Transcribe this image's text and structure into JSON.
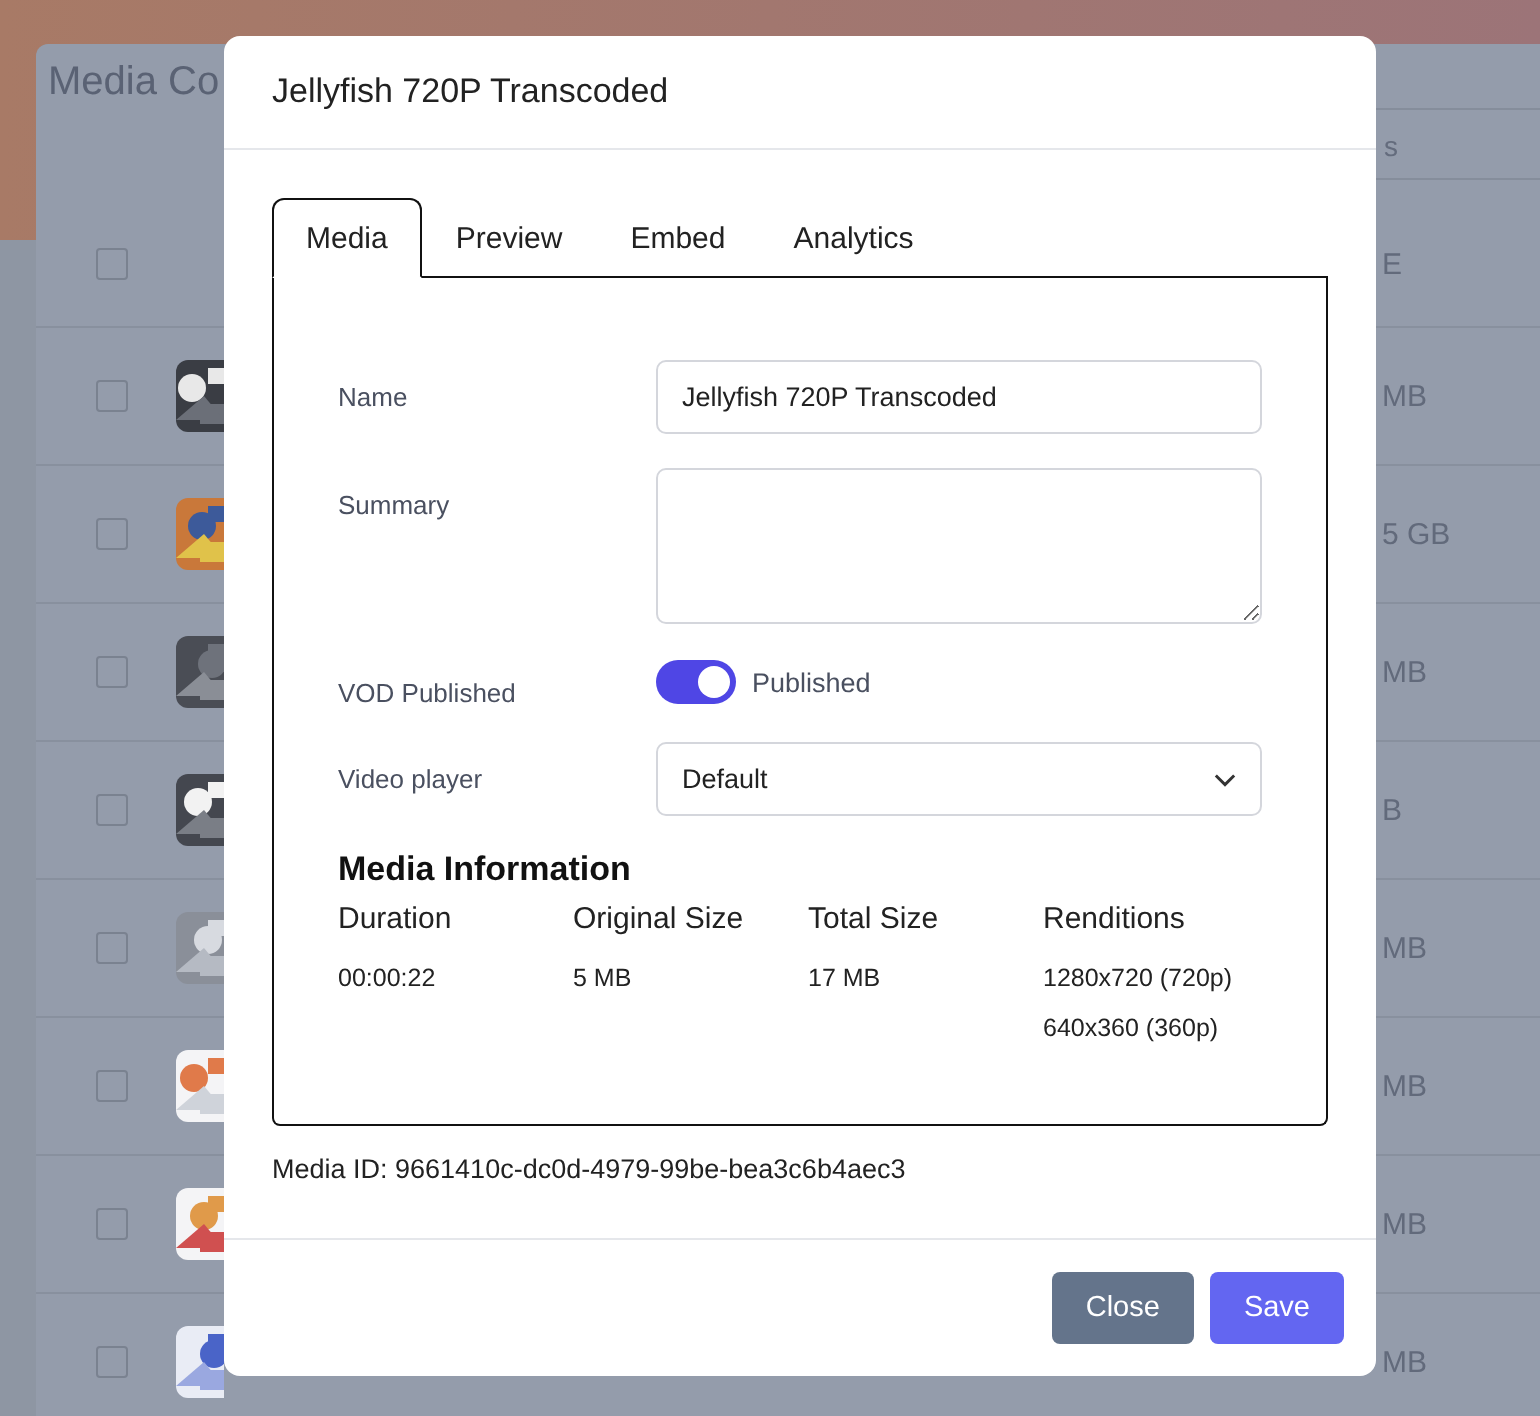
{
  "background": {
    "title": "Media Co",
    "search_text": "s",
    "header": {
      "checked": false,
      "size": "E"
    },
    "rows": [
      {
        "checked": false,
        "size": "MB"
      },
      {
        "checked": false,
        "size": "5 GB"
      },
      {
        "checked": false,
        "size": "MB"
      },
      {
        "checked": false,
        "size": "B"
      },
      {
        "checked": false,
        "size": "MB"
      },
      {
        "checked": false,
        "size": "MB"
      },
      {
        "checked": false,
        "size": "MB"
      },
      {
        "checked": false,
        "size": "MB"
      }
    ]
  },
  "dialog": {
    "title": "Jellyfish 720P Transcoded",
    "tabs": [
      {
        "label": "Media",
        "selected": true
      },
      {
        "label": "Preview",
        "selected": false
      },
      {
        "label": "Embed",
        "selected": false
      },
      {
        "label": "Analytics",
        "selected": false
      }
    ],
    "fields": [
      {
        "kind": "text",
        "label": "Name",
        "value": "Jellyfish 720P Transcoded"
      },
      {
        "kind": "textarea",
        "label": "Summary"
      },
      {
        "kind": "toggle",
        "label": "VOD Published",
        "on": true,
        "text": "Published"
      },
      {
        "kind": "select",
        "label": "Video player",
        "value": "Default"
      }
    ],
    "media_information": {
      "heading": "Media Information",
      "columns": [
        {
          "label": "Duration",
          "values": [
            "00:00:22"
          ]
        },
        {
          "label": "Original Size",
          "values": [
            "5 MB"
          ]
        },
        {
          "label": "Total Size",
          "values": [
            "17 MB"
          ]
        },
        {
          "label": "Renditions",
          "values": [
            "1280x720 (720p)",
            "640x360 (360p)"
          ]
        }
      ]
    },
    "media_id": "Media ID: 9661410c-dc0d-4979-99be-bea3c6b4aec3",
    "buttons": [
      {
        "label": "Close",
        "kind": "secondary"
      },
      {
        "label": "Save",
        "kind": "primary"
      }
    ]
  }
}
